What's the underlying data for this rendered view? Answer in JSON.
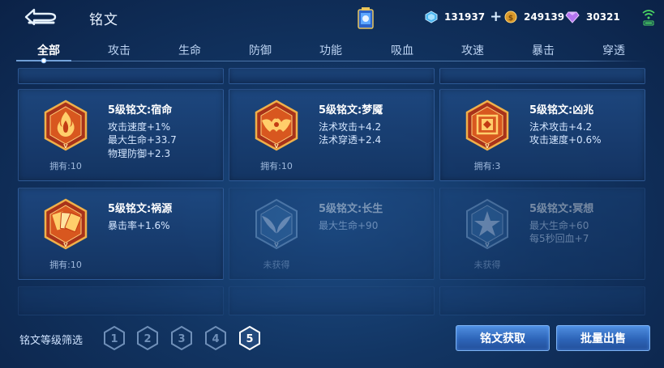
{
  "header": {
    "title": "铭文",
    "currencies": [
      {
        "name": "diamond",
        "value": "131937",
        "icon": "blue-diamond-icon",
        "has_plus": true
      },
      {
        "name": "gold",
        "value": "249139",
        "icon": "gold-coin-icon",
        "has_plus": false
      },
      {
        "name": "gem",
        "value": "30321",
        "icon": "purple-gem-icon",
        "has_plus": false
      }
    ]
  },
  "tabs": [
    "全部",
    "攻击",
    "生命",
    "防御",
    "功能",
    "吸血",
    "攻速",
    "暴击",
    "穿透"
  ],
  "active_tab": 0,
  "inscriptions": [
    {
      "name": "5级铭文:宿命",
      "attrs": [
        "攻击速度+1%",
        "最大生命+33.7",
        "物理防御+2.3"
      ],
      "owned": "拥有:10",
      "color": "red",
      "obtained": true
    },
    {
      "name": "5级铭文:梦魇",
      "attrs": [
        "法术攻击+4.2",
        "法术穿透+2.4"
      ],
      "owned": "拥有:10",
      "color": "red",
      "obtained": true
    },
    {
      "name": "5级铭文:凶兆",
      "attrs": [
        "法术攻击+4.2",
        "攻击速度+0.6%"
      ],
      "owned": "拥有:3",
      "color": "red",
      "obtained": true
    },
    {
      "name": "5级铭文:祸源",
      "attrs": [
        "暴击率+1.6%"
      ],
      "owned": "拥有:10",
      "color": "red",
      "obtained": true
    },
    {
      "name": "5级铭文:长生",
      "attrs": [
        "最大生命+90"
      ],
      "owned": "未获得",
      "color": "blue",
      "obtained": false
    },
    {
      "name": "5级铭文:冥想",
      "attrs": [
        "最大生命+60",
        "每5秒回血+7"
      ],
      "owned": "未获得",
      "color": "blue",
      "obtained": false
    }
  ],
  "footer": {
    "filter_label": "铭文等级筛选",
    "levels": [
      "1",
      "2",
      "3",
      "4",
      "5"
    ],
    "selected_level": "5",
    "buttons": {
      "obtain": "铭文获取",
      "sell": "批量出售"
    }
  },
  "colors": {
    "accent": "#3a78d0",
    "active_level": "#ffffff",
    "inactive_level": "#6f8fb8"
  }
}
